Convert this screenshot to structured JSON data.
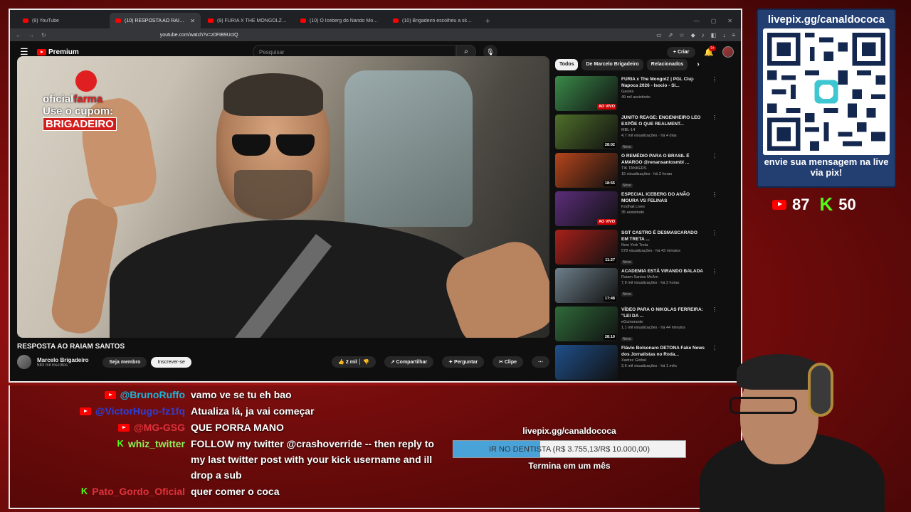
{
  "browser": {
    "tabs": [
      {
        "label": "(9) YouTube",
        "active": false
      },
      {
        "label": "(10) RESPOSTA AO RAIAM SA",
        "active": true
      },
      {
        "label": "(9) FURIA X THE MONGOLZ - PGL CL",
        "active": false
      },
      {
        "label": "(10) O Iceberg do Nando Moura - Yo",
        "active": false
      },
      {
        "label": "(10) Brigadeiro escolheu a skin de Cr",
        "active": false
      }
    ],
    "url": "youtube.com/watch?v=z0FtB9UctQ"
  },
  "youtube": {
    "logo_label": "Premium",
    "search_placeholder": "Pesquisar",
    "create_label": "Criar",
    "notif_count": "9+",
    "video_title": "RESPOSTA AO RAIAM SANTOS",
    "channel_name": "Marcelo Brigadeiro",
    "channel_subs": "583 mil inscritos",
    "join_label": "Seja membro",
    "subscribe_label": "Inscrever-se",
    "likes": "2 mil",
    "share_label": "Compartilhar",
    "ask_label": "Perguntar",
    "clip_label": "Clipe",
    "chips": [
      "Todos",
      "De Marcelo Brigadeiro",
      "Relacionados"
    ],
    "video_overlay": {
      "brand_a": "oficial",
      "brand_b": "farma",
      "line": "Use o cupom:",
      "code": "BRIGADEIRO"
    },
    "recommendations": [
      {
        "title": "FURIA x The MongolZ | PGL Cluj-Napoca 2026 - Isocio - SI...",
        "channel": "Gaules",
        "meta": "49 mil assistindo",
        "badge": "AO VIVO",
        "new": "",
        "thumb": "#3a8a4a"
      },
      {
        "title": "JUNITO REAGE: ENGENHEIRO LEO EXPÕE O QUE REALMENT...",
        "channel": "MBL-14",
        "meta": "4,7 mil visualizações · há 4 dias",
        "badge": "28:02",
        "new": "Novo",
        "thumb": "#4f6f2a"
      },
      {
        "title": "O REMÉDIO PARA O BRASIL É AMARGO @renansantosmbl ...",
        "channel": "TIK TANKERS",
        "meta": "15 visualizações · há 2 horas",
        "badge": "18:55",
        "new": "Novo",
        "thumb": "#b5451b"
      },
      {
        "title": "ESPECIAL ICEBERG DO ANÃO MOURA VS FELINAS",
        "channel": "Kodhak Lives",
        "meta": "35 assistindo",
        "badge": "AO VIVO",
        "new": "",
        "thumb": "#5b2d7a"
      },
      {
        "title": "SGT CASTRO É DESMASCARADO EM TRETA ...",
        "channel": "New York Treta",
        "meta": "578 visualizações · há 43 minutos",
        "badge": "11:27",
        "new": "Novo",
        "thumb": "#a8201a"
      },
      {
        "title": "ACADEMIA ESTÁ VIRANDO BALADA",
        "channel": "Raiam Santos McAm",
        "meta": "7,9 mil visualizações · há 2 horas",
        "badge": "17:48",
        "new": "Novo",
        "thumb": "#6d7f8a"
      },
      {
        "title": "VÍDEO PARA O NIKOLAS FERREIRA: \"LEI DA ...",
        "channel": "eGuinorante",
        "meta": "1,1 mil visualizações · há 44 minutos",
        "badge": "28:10",
        "new": "Novo",
        "thumb": "#2f6a3a"
      },
      {
        "title": "Flávio Bolsonaro DETONA Fake News dos Jornalistas no Roda...",
        "channel": "Xadrez Global",
        "meta": "2,6 mil visualizações · há 1 mês",
        "badge": "",
        "new": "",
        "thumb": "#1f4f8a"
      }
    ]
  },
  "overlay": {
    "pix_url": "livepix.gg/canaldococa",
    "pix_message": "envie sua mensagem na live via pix!",
    "yt_count": "87",
    "kick_count": "50",
    "goal_url": "livepix.gg/canaldococa",
    "goal_label": "IR NO DENTISTA (R$ 3.755,13/R$ 10.000,00)",
    "goal_progress": 0.3755,
    "goal_subtitle": "Termina em um mês",
    "kick_glyph": "K"
  },
  "chat": [
    {
      "platform": "youtube",
      "user": "@BrunoRuffo",
      "color": "#1fb5d8",
      "text": "vamo ve se tu eh bao"
    },
    {
      "platform": "youtube",
      "user": "@VictorHugo-fz1fq",
      "color": "#2a40d8",
      "text": "Atualiza lá, ja vai começar"
    },
    {
      "platform": "youtube",
      "user": "@MG-GSG",
      "color": "#e0323c",
      "text": "QUE PORRA MANO"
    },
    {
      "platform": "kick",
      "user": "whiz_twitter",
      "color": "#8ef05a",
      "text": "FOLLOW my twitter @crashoverride -- then reply to my last twitter post with your kick username and ill drop a sub"
    },
    {
      "platform": "kick",
      "user": "Pato_Gordo_Oficial",
      "color": "#e0323c",
      "text": "quer comer o coca"
    }
  ]
}
